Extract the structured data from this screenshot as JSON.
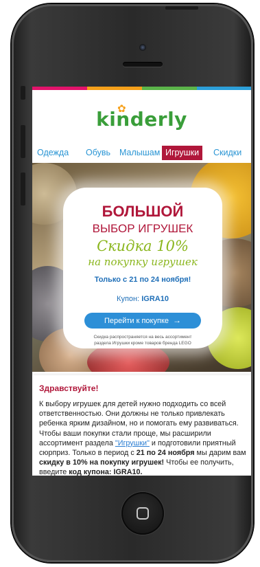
{
  "brand": {
    "logo_text": "kinderly"
  },
  "nav": {
    "items": [
      "Одежда",
      "Обувь",
      "Малышам",
      "Игрушки",
      "Скидки"
    ],
    "active": "Игрушки"
  },
  "banner": {
    "headline_big": "БОЛЬШОЙ",
    "headline_small": "ВЫБОР ИГРУШЕК",
    "promo_line1": "Скидка 10%",
    "promo_line2": "на покупку игрушек",
    "dates": "Только с 21 по 24 ноября!",
    "coupon_label": "Купон:",
    "coupon_code": "IGRA10",
    "cta_label": "Перейти к покупке",
    "fine_print_line1": "Скидка распространяется на весь ассортимент",
    "fine_print_line2": "раздела Игрушки кроме товаров бренда LEGO"
  },
  "body": {
    "greeting": "Здравствуйте!",
    "p1": "К выбору игрушек для детей нужно подходить со всей ответственностью. Они должны не только привлекать ребенка ярким дизайном, но и помогать ему развиваться. Чтобы ваши покупки стали проще, мы расширили ассортимент раздела ",
    "link_text": "\"Игрушки\"",
    "p2": " и подготовили приятный сюрприз. Только в период с ",
    "dates_bold": "21 по 24 ноября",
    "p3": " мы дарим вам ",
    "offer_bold": "скидку в 10% на покупку игрушек!",
    "p4": " Чтобы ее получить, введите ",
    "code_bold": "код купона: IGRA10."
  },
  "colors": {
    "brand_red": "#b0173a",
    "brand_green": "#3a9e3a",
    "link_blue": "#2a95d4",
    "cta_blue": "#2d8fd7",
    "promo_green": "#8ab61d"
  }
}
